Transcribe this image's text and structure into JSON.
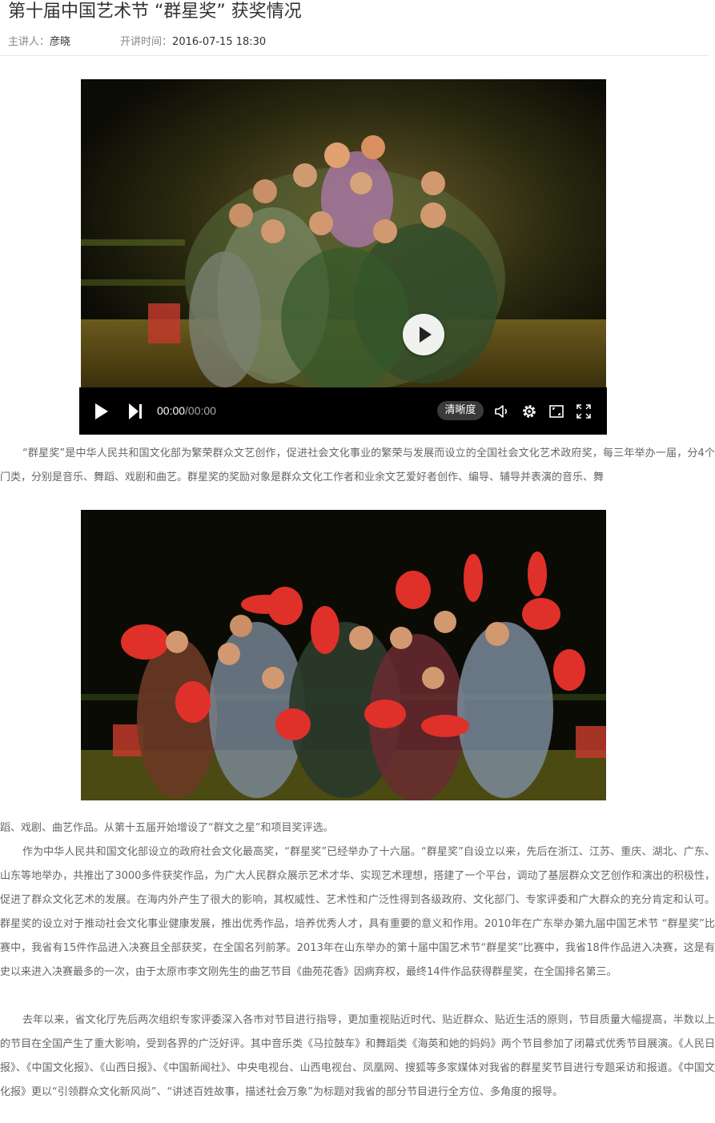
{
  "article": {
    "title": "第十届中国艺术节 “群星奖” 获奖情况",
    "presenter_label": "主讲人：",
    "presenter": "彦晓",
    "time_label": "开讲时间：",
    "time": "2016-07-15  18:30"
  },
  "player": {
    "current_time": "00:00",
    "duration": "/00:00",
    "quality_label": "清晰度",
    "icons": [
      "play-icon",
      "next-icon",
      "volume-icon",
      "settings-icon",
      "window-icon",
      "fullscreen-icon"
    ]
  },
  "content": {
    "p1": "“群星奖”是中华人民共和国文化部为繁荣群众文艺创作，促进社会文化事业的繁荣与发展而设立的全国社会文化艺术政府奖，每三年举办一届，分4个门类，分别是音乐、舞蹈、戏剧和曲艺。群星奖的奖励对象是群众文化工作者和业余文艺爱好者创作、编导、辅导并表演的音乐、舞",
    "p1_cont": "蹈、戏剧、曲艺作品。从第十五届开始增设了“群文之星”和项目奖评选。",
    "p2": "作为中华人民共和国文化部设立的政府社会文化最高奖，“群星奖”已经举办了十六届。“群星奖”自设立以来，先后在浙江、江苏、重庆、湖北、广东、山东等地举办，共推出了3000多件获奖作品，为广大人民群众展示艺术才华、实现艺术理想，搭建了一个平台，调动了基层群众文艺创作和演出的积极性，促进了群众文化艺术的发展。在海内外产生了很大的影响，其权威性、艺术性和广泛性得到各级政府、文化部门、专家评委和广大群众的充分肯定和认可。群星奖的设立对于推动社会文化事业健康发展，推出优秀作品，培养优秀人才，具有重要的意义和作用。2010年在广东举办第九届中国艺术节 “群星奖”比赛中，我省有15件作品进入决赛且全部获奖，在全国名列前茅。2013年在山东举办的第十届中国艺术节“群星奖”比赛中，我省18件作品进入决赛，这是有史以来进入决赛最多的一次，由于太原市李文刚先生的曲艺节目《曲苑花香》因病弃权，最终14件作品获得群星奖，在全国排名第三。",
    "p3": "去年以来，省文化厅先后两次组织专家评委深入各市对节目进行指导，更加重视贴近时代、贴近群众、贴近生活的原则，节目质量大幅提高，半数以上的节目在全国产生了重大影响，受到各界的广泛好评。其中音乐类《马拉鼓车》和舞蹈类《海英和她的妈妈》两个节目参加了闭幕式优秀节目展演。《人民日报》、《中国文化报》、《山西日报》、《中国新闻社》、中央电视台、山西电视台、凤凰网、搜狐等多家媒体对我省的群星奖节目进行专题采访和报道。《中国文化报》更以“引领群众文化新风尚”、“讲述百姓故事，描述社会万象”为标题对我省的部分节目进行全方位、多角度的报导。"
  }
}
